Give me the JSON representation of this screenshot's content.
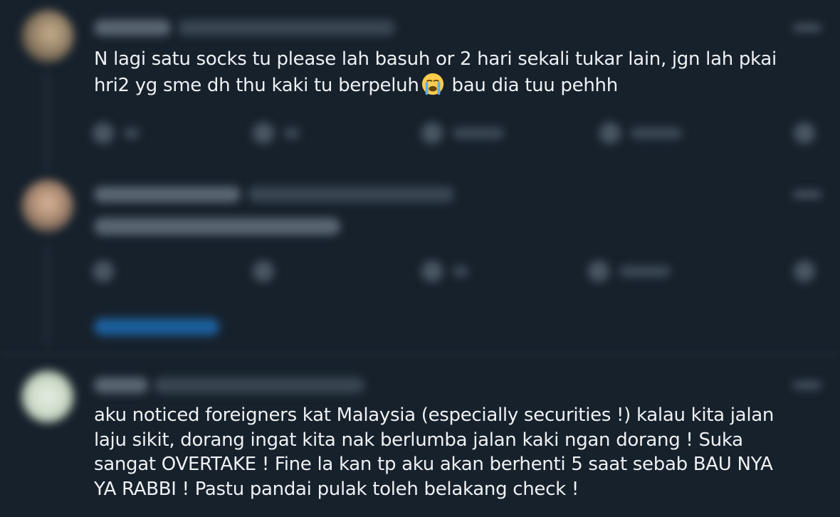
{
  "tweets": [
    {
      "text": "N lagi satu socks tu please lah basuh or 2 hari sekali tukar lain, jgn lah pkai\nhri2 yg sme dh thu kaki tu berpeluh",
      "emoji": "loudly-crying-face",
      "text_after_emoji": " bau dia tuu pehhh"
    },
    {
      "text": "aku noticed foreigners kat Malaysia (especially securities !) kalau kita jalan\nlaju sikit, dorang ingat kita nak berlumba jalan kaki ngan dorang ! Suka\nsangat OVERTAKE ! Fine la kan tp aku akan berhenti 5 saat sebab BAU NYA\nYA RABBI ! Pastu pandai pulak toleh belakang check !"
    }
  ],
  "colors": {
    "background": "#17212c",
    "text": "#eef1f3",
    "link": "#1d9bf0"
  }
}
